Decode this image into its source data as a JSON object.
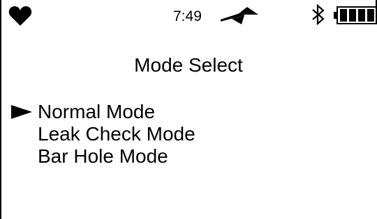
{
  "status_bar": {
    "time": "7:49",
    "icons": [
      "heart-icon",
      "signal-icon",
      "bluetooth-icon",
      "battery-icon"
    ],
    "battery_level_fraction": 1.0
  },
  "screen": {
    "title": "Mode Select",
    "selected_index": 0,
    "modes": [
      {
        "label": "Normal Mode",
        "selected": true
      },
      {
        "label": "Leak Check Mode",
        "selected": false
      },
      {
        "label": "Bar Hole Mode",
        "selected": false
      }
    ]
  },
  "colors": {
    "foreground": "#000000",
    "background": "#ffffff"
  }
}
